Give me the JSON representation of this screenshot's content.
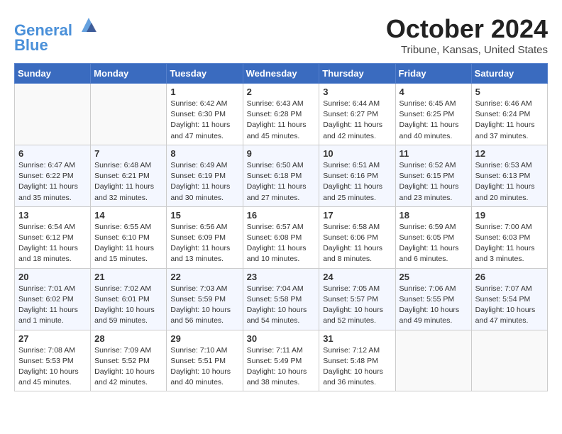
{
  "header": {
    "logo_line1": "General",
    "logo_line2": "Blue",
    "month": "October 2024",
    "location": "Tribune, Kansas, United States"
  },
  "weekdays": [
    "Sunday",
    "Monday",
    "Tuesday",
    "Wednesday",
    "Thursday",
    "Friday",
    "Saturday"
  ],
  "weeks": [
    [
      {
        "day": "",
        "info": ""
      },
      {
        "day": "",
        "info": ""
      },
      {
        "day": "1",
        "info": "Sunrise: 6:42 AM\nSunset: 6:30 PM\nDaylight: 11 hours and 47 minutes."
      },
      {
        "day": "2",
        "info": "Sunrise: 6:43 AM\nSunset: 6:28 PM\nDaylight: 11 hours and 45 minutes."
      },
      {
        "day": "3",
        "info": "Sunrise: 6:44 AM\nSunset: 6:27 PM\nDaylight: 11 hours and 42 minutes."
      },
      {
        "day": "4",
        "info": "Sunrise: 6:45 AM\nSunset: 6:25 PM\nDaylight: 11 hours and 40 minutes."
      },
      {
        "day": "5",
        "info": "Sunrise: 6:46 AM\nSunset: 6:24 PM\nDaylight: 11 hours and 37 minutes."
      }
    ],
    [
      {
        "day": "6",
        "info": "Sunrise: 6:47 AM\nSunset: 6:22 PM\nDaylight: 11 hours and 35 minutes."
      },
      {
        "day": "7",
        "info": "Sunrise: 6:48 AM\nSunset: 6:21 PM\nDaylight: 11 hours and 32 minutes."
      },
      {
        "day": "8",
        "info": "Sunrise: 6:49 AM\nSunset: 6:19 PM\nDaylight: 11 hours and 30 minutes."
      },
      {
        "day": "9",
        "info": "Sunrise: 6:50 AM\nSunset: 6:18 PM\nDaylight: 11 hours and 27 minutes."
      },
      {
        "day": "10",
        "info": "Sunrise: 6:51 AM\nSunset: 6:16 PM\nDaylight: 11 hours and 25 minutes."
      },
      {
        "day": "11",
        "info": "Sunrise: 6:52 AM\nSunset: 6:15 PM\nDaylight: 11 hours and 23 minutes."
      },
      {
        "day": "12",
        "info": "Sunrise: 6:53 AM\nSunset: 6:13 PM\nDaylight: 11 hours and 20 minutes."
      }
    ],
    [
      {
        "day": "13",
        "info": "Sunrise: 6:54 AM\nSunset: 6:12 PM\nDaylight: 11 hours and 18 minutes."
      },
      {
        "day": "14",
        "info": "Sunrise: 6:55 AM\nSunset: 6:10 PM\nDaylight: 11 hours and 15 minutes."
      },
      {
        "day": "15",
        "info": "Sunrise: 6:56 AM\nSunset: 6:09 PM\nDaylight: 11 hours and 13 minutes."
      },
      {
        "day": "16",
        "info": "Sunrise: 6:57 AM\nSunset: 6:08 PM\nDaylight: 11 hours and 10 minutes."
      },
      {
        "day": "17",
        "info": "Sunrise: 6:58 AM\nSunset: 6:06 PM\nDaylight: 11 hours and 8 minutes."
      },
      {
        "day": "18",
        "info": "Sunrise: 6:59 AM\nSunset: 6:05 PM\nDaylight: 11 hours and 6 minutes."
      },
      {
        "day": "19",
        "info": "Sunrise: 7:00 AM\nSunset: 6:03 PM\nDaylight: 11 hours and 3 minutes."
      }
    ],
    [
      {
        "day": "20",
        "info": "Sunrise: 7:01 AM\nSunset: 6:02 PM\nDaylight: 11 hours and 1 minute."
      },
      {
        "day": "21",
        "info": "Sunrise: 7:02 AM\nSunset: 6:01 PM\nDaylight: 10 hours and 59 minutes."
      },
      {
        "day": "22",
        "info": "Sunrise: 7:03 AM\nSunset: 5:59 PM\nDaylight: 10 hours and 56 minutes."
      },
      {
        "day": "23",
        "info": "Sunrise: 7:04 AM\nSunset: 5:58 PM\nDaylight: 10 hours and 54 minutes."
      },
      {
        "day": "24",
        "info": "Sunrise: 7:05 AM\nSunset: 5:57 PM\nDaylight: 10 hours and 52 minutes."
      },
      {
        "day": "25",
        "info": "Sunrise: 7:06 AM\nSunset: 5:55 PM\nDaylight: 10 hours and 49 minutes."
      },
      {
        "day": "26",
        "info": "Sunrise: 7:07 AM\nSunset: 5:54 PM\nDaylight: 10 hours and 47 minutes."
      }
    ],
    [
      {
        "day": "27",
        "info": "Sunrise: 7:08 AM\nSunset: 5:53 PM\nDaylight: 10 hours and 45 minutes."
      },
      {
        "day": "28",
        "info": "Sunrise: 7:09 AM\nSunset: 5:52 PM\nDaylight: 10 hours and 42 minutes."
      },
      {
        "day": "29",
        "info": "Sunrise: 7:10 AM\nSunset: 5:51 PM\nDaylight: 10 hours and 40 minutes."
      },
      {
        "day": "30",
        "info": "Sunrise: 7:11 AM\nSunset: 5:49 PM\nDaylight: 10 hours and 38 minutes."
      },
      {
        "day": "31",
        "info": "Sunrise: 7:12 AM\nSunset: 5:48 PM\nDaylight: 10 hours and 36 minutes."
      },
      {
        "day": "",
        "info": ""
      },
      {
        "day": "",
        "info": ""
      }
    ]
  ]
}
